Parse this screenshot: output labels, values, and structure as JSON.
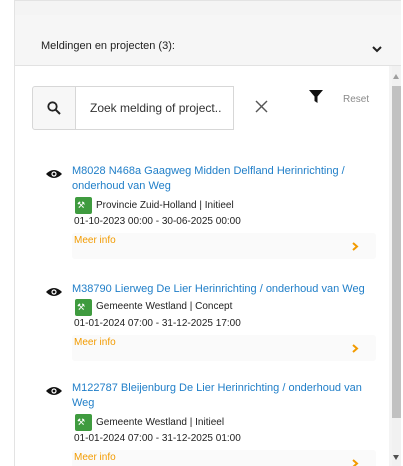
{
  "header": {
    "title": "Meldingen en projecten (3):"
  },
  "search": {
    "placeholder": "Zoek melding of project.."
  },
  "toolbar": {
    "reset_label": "Reset"
  },
  "colors": {
    "link": "#1f7ec8",
    "badge": "#3f9b3f",
    "more": "#f29b00"
  },
  "icons": {
    "search": "search-icon",
    "clear": "close-icon",
    "filter": "filter-icon",
    "view": "eye-icon",
    "badge": "roadwork-icon",
    "expand": "chevron-down-icon",
    "more": "chevron-right-icon"
  },
  "items": [
    {
      "title": "M8028 N468a Gaagweg Midden Delfland Herinrichting / onderhoud van Weg",
      "org": "Provincie Zuid-Holland | Initieel",
      "date": "01-10-2023 00:00 - 30-06-2025 00:00",
      "more": "Meer info"
    },
    {
      "title": "M38790 Lierweg De Lier Herinrichting / onderhoud van Weg",
      "org": "Gemeente Westland | Concept",
      "date": "01-01-2024 07:00 - 31-12-2025 17:00",
      "more": "Meer info"
    },
    {
      "title": "M122787 Bleijenburg De Lier Herinrichting / onderhoud van Weg",
      "org": "Gemeente Westland | Initieel",
      "date": "01-01-2024 07:00 - 31-12-2025 01:00",
      "more": "Meer info"
    }
  ]
}
